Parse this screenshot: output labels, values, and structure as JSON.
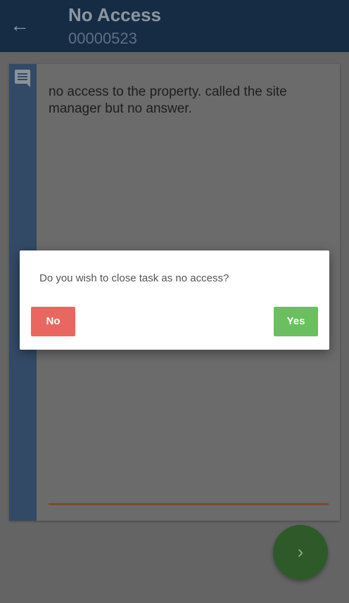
{
  "header": {
    "title": "No Access",
    "subtitle": "00000523",
    "back_icon": "arrow-left-icon"
  },
  "note": {
    "text": "no access to the property. called the site manager but no answer.",
    "icon": "comment-icon"
  },
  "fab": {
    "icon": "chevron-right-icon",
    "glyph": "›"
  },
  "dialog": {
    "message": "Do you wish to close task as no access?",
    "no_label": "No",
    "yes_label": "Yes",
    "no_color": "#e8685f",
    "yes_color": "#6abf5f"
  }
}
